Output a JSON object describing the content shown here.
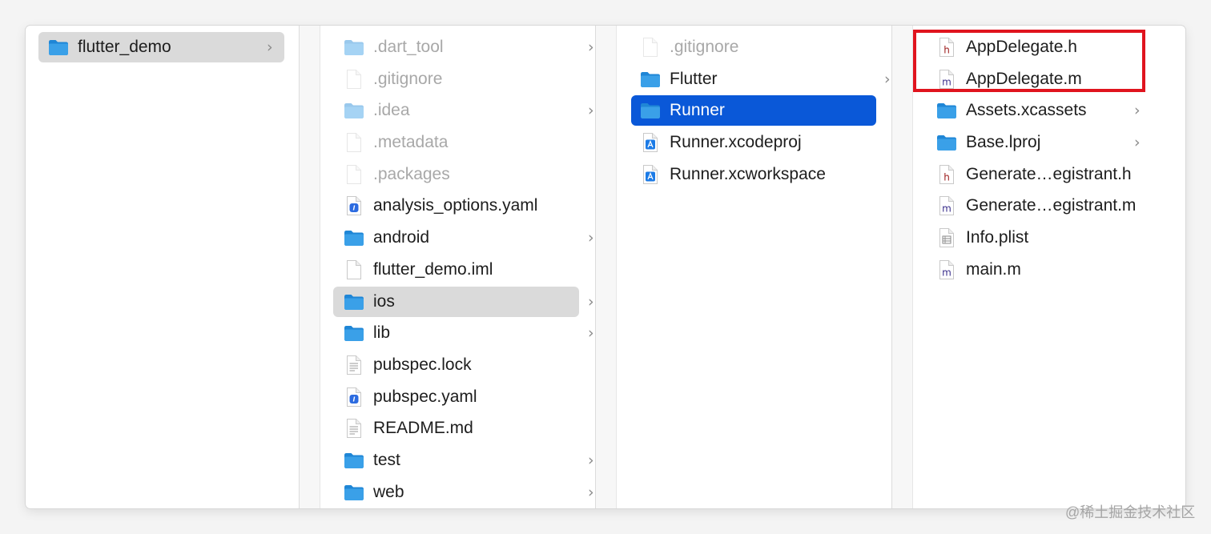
{
  "columns": [
    {
      "items": [
        {
          "label": "flutter_demo",
          "type": "folder",
          "has_children": true,
          "state": "selected-inactive"
        }
      ]
    },
    {
      "items": [
        {
          "label": ".dart_tool",
          "type": "folder",
          "has_children": true,
          "hidden": true
        },
        {
          "label": ".gitignore",
          "type": "file",
          "hidden": true
        },
        {
          "label": ".idea",
          "type": "folder",
          "has_children": true,
          "hidden": true
        },
        {
          "label": ".metadata",
          "type": "file",
          "hidden": true
        },
        {
          "label": ".packages",
          "type": "file",
          "hidden": true
        },
        {
          "label": "analysis_options.yaml",
          "type": "yaml"
        },
        {
          "label": "android",
          "type": "folder",
          "has_children": true
        },
        {
          "label": "flutter_demo.iml",
          "type": "file"
        },
        {
          "label": "ios",
          "type": "folder",
          "has_children": true,
          "state": "selected-inactive"
        },
        {
          "label": "lib",
          "type": "folder",
          "has_children": true
        },
        {
          "label": "pubspec.lock",
          "type": "text"
        },
        {
          "label": "pubspec.yaml",
          "type": "yaml"
        },
        {
          "label": "README.md",
          "type": "text"
        },
        {
          "label": "test",
          "type": "folder",
          "has_children": true
        },
        {
          "label": "web",
          "type": "folder",
          "has_children": true
        }
      ]
    },
    {
      "items": [
        {
          "label": ".gitignore",
          "type": "file",
          "hidden": true
        },
        {
          "label": "Flutter",
          "type": "folder",
          "has_children": true
        },
        {
          "label": "Runner",
          "type": "folder",
          "has_children": true,
          "state": "selected-active"
        },
        {
          "label": "Runner.xcodeproj",
          "type": "xcodeproj"
        },
        {
          "label": "Runner.xcworkspace",
          "type": "xcworkspace"
        }
      ]
    },
    {
      "items": [
        {
          "label": "AppDelegate.h",
          "type": "h",
          "glyph": "h"
        },
        {
          "label": "AppDelegate.m",
          "type": "m",
          "glyph": "m"
        },
        {
          "label": "Assets.xcassets",
          "type": "folder",
          "has_children": true
        },
        {
          "label": "Base.lproj",
          "type": "folder",
          "has_children": true
        },
        {
          "label": "Generate…egistrant.h",
          "type": "h",
          "glyph": "h"
        },
        {
          "label": "Generate…egistrant.m",
          "type": "m",
          "glyph": "m"
        },
        {
          "label": "Info.plist",
          "type": "plist"
        },
        {
          "label": "main.m",
          "type": "m",
          "glyph": "m"
        }
      ]
    }
  ],
  "chevron_glyph": "›",
  "watermark": "@稀土掘金技术社区",
  "colors": {
    "selection_active": "#0a58d8",
    "selection_inactive": "#dadada",
    "folder": "#3aa0e8",
    "highlight_box": "#e0141e",
    "h_glyph": "#9b1b1b",
    "m_glyph": "#3a2f8c"
  }
}
